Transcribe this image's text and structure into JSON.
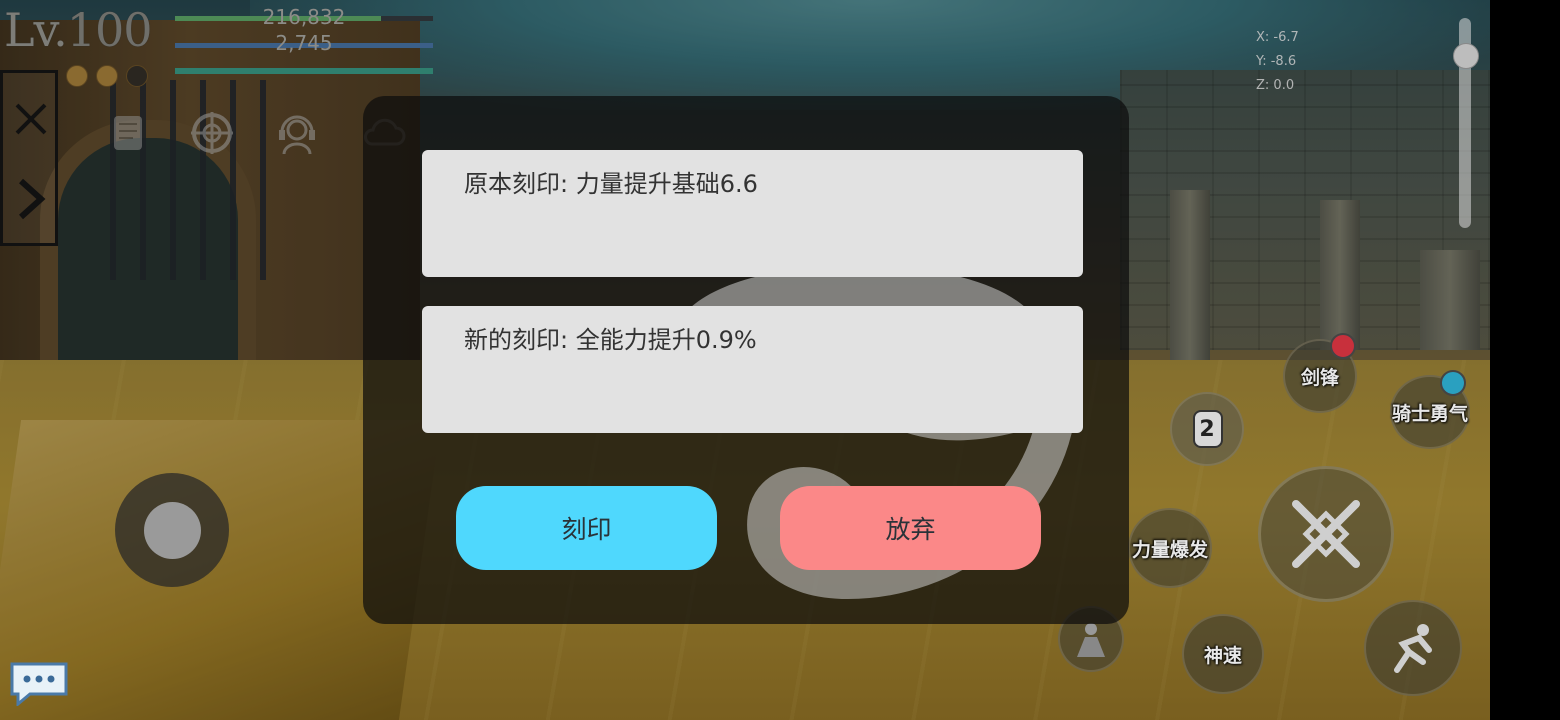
{
  "hud": {
    "level_prefix": "Lv.",
    "level_value": "100",
    "hp_value": "216,832",
    "mp_value": "2,745",
    "hp_ratio": 0.8,
    "mp_ratio": 1.0,
    "xp_ratio": 1.0,
    "charges_filled": 2,
    "charges_total": 3
  },
  "coords": {
    "x": "X: -6.7",
    "y": "Y: -8.6",
    "z": "Z: 0.0"
  },
  "dialog": {
    "original_label": "原本刻印: 力量提升基础6.6",
    "new_label": "新的刻印: 全能力提升0.9%",
    "engrave_button": "刻印",
    "discard_button": "放弃"
  },
  "skills": {
    "sword_edge": "剑锋",
    "knight_courage": "骑士勇气",
    "power_burst": "力量爆发",
    "divine_speed": "神速",
    "slot_number": "2"
  },
  "colors": {
    "engrave_button": "#4fd8fd",
    "discard_button": "#fb8888",
    "card_bg": "#e2e2e2",
    "hp_bar": "#4d8a55",
    "mp_bar": "#3b5f88"
  }
}
